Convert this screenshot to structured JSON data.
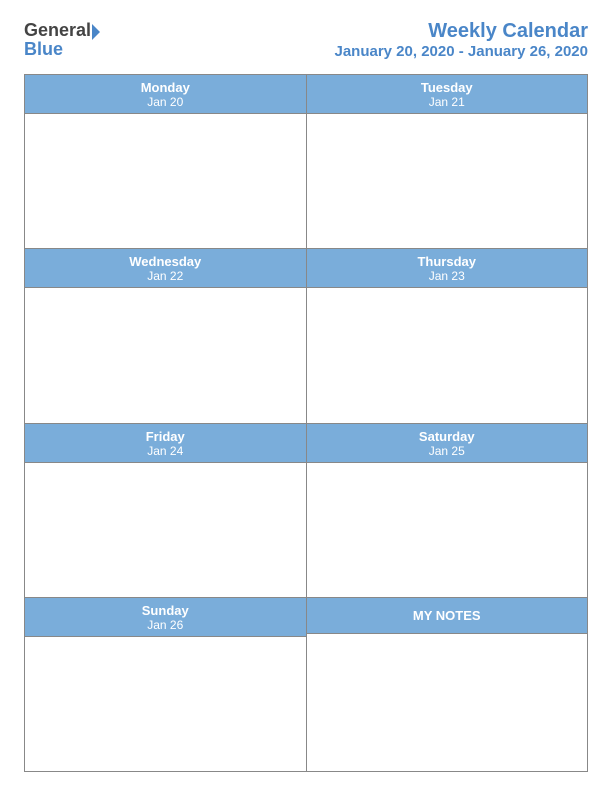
{
  "header": {
    "logo": {
      "general": "General",
      "triangle": "",
      "blue": "Blue"
    },
    "title": "Weekly Calendar",
    "date_range": "January 20, 2020 - January 26, 2020"
  },
  "calendar": {
    "rows": [
      {
        "cells": [
          {
            "day_name": "Monday",
            "day_date": "Jan 20"
          },
          {
            "day_name": "Tuesday",
            "day_date": "Jan 21"
          }
        ]
      },
      {
        "cells": [
          {
            "day_name": "Wednesday",
            "day_date": "Jan 22"
          },
          {
            "day_name": "Thursday",
            "day_date": "Jan 23"
          }
        ]
      },
      {
        "cells": [
          {
            "day_name": "Friday",
            "day_date": "Jan 24"
          },
          {
            "day_name": "Saturday",
            "day_date": "Jan 25"
          }
        ]
      },
      {
        "cells": [
          {
            "day_name": "Sunday",
            "day_date": "Jan 26"
          },
          {
            "day_name": "MY NOTES",
            "day_date": ""
          }
        ]
      }
    ]
  }
}
